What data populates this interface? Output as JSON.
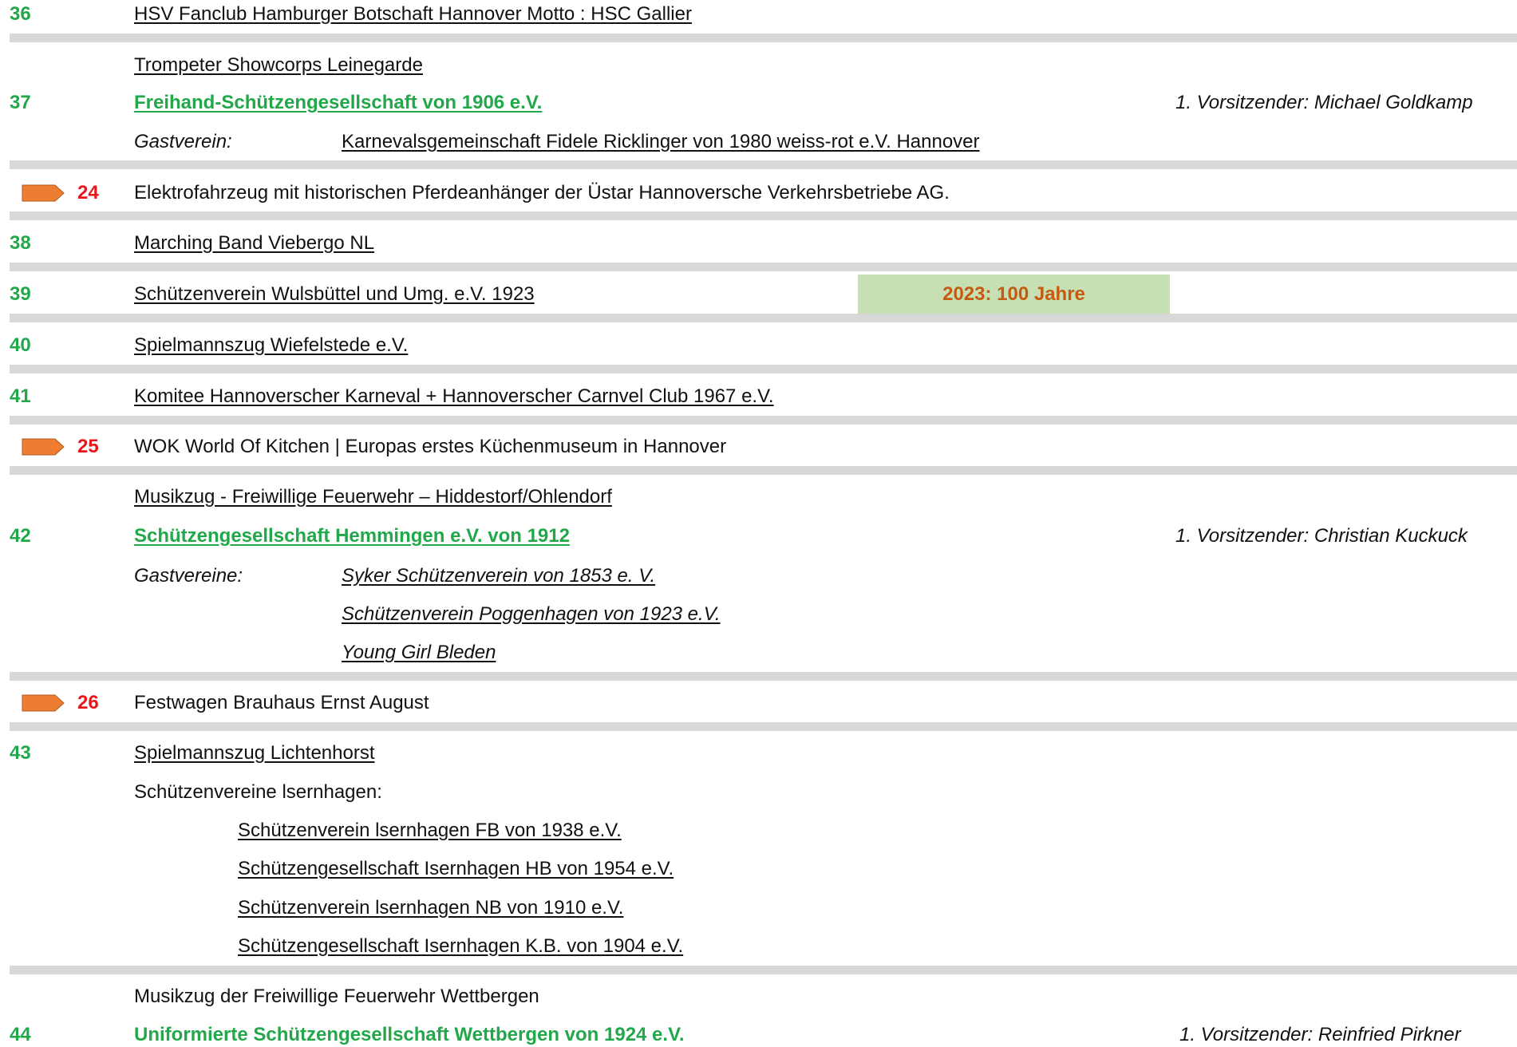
{
  "colors": {
    "green": "#22a84a",
    "red": "#e8161b",
    "arrow": "#ed7d31",
    "separator": "#d8d8d8",
    "badge_bg": "#c6e0b4",
    "badge_text": "#c55a11"
  },
  "icons": {
    "marker": "arrow-right-shape-icon"
  },
  "rows": {
    "r36": {
      "num": "36",
      "name": "HSV Fanclub Hamburger Botschaft Hannover Motto : HSC Gallier"
    },
    "r37": {
      "pre": "Trompeter Showcorps Leinegarde",
      "num": "37",
      "name": "Freihand-Schützengesellschaft von 1906 e.V.",
      "chair": "1. Vorsitzender: Michael Goldkamp",
      "guest_label": "Gastverein:",
      "guest": "Karnevalsgemeinschaft Fidele Ricklinger von 1980 weiss-rot e.V. Hannover"
    },
    "w24": {
      "num": "24",
      "name": "Elektrofahrzeug mit historischen Pferdeanhänger  der Üstar Hannoversche Verkehrsbetriebe AG."
    },
    "r38": {
      "num": "38",
      "name": "Marching Band Viebergo NL"
    },
    "r39": {
      "num": "39",
      "name": "Schützenverein Wulsbüttel und Umg. e.V. 1923",
      "badge": "2023: 100 Jahre"
    },
    "r40": {
      "num": "40",
      "name": "Spielmannszug Wiefelstede e.V."
    },
    "r41": {
      "num": "41",
      "name": "Komitee Hannoverscher Karneval + Hannoverscher Carnvel Club 1967 e.V."
    },
    "w25": {
      "num": "25",
      "name": "WOK World Of Kitchen | Europas erstes Küchenmuseum in Hannover"
    },
    "r42": {
      "pre": "Musikzug - Freiwillige Feuerwehr – Hiddestorf/Ohlendorf",
      "num": "42",
      "name": "Schützengesellschaft Hemmingen e.V. von 1912",
      "chair": "1. Vorsitzender: Christian Kuckuck",
      "guest_label": "Gastvereine:",
      "guests": [
        "Syker Schützenverein von 1853 e. V.",
        "Schützenverein Poggenhagen von 1923 e.V.",
        "Young Girl Bleden "
      ]
    },
    "w26": {
      "num": "26",
      "name": "Festwagen Brauhaus Ernst August"
    },
    "r43": {
      "num": "43",
      "name": "Spielmannszug Lichtenhorst",
      "group_label": "Schützenvereine lsernhagen:",
      "clubs": [
        "Schützenverein lsernhagen FB von 1938 e.V.",
        "Schützengesellschaft Isernhagen HB von 1954 e.V.",
        "Schützenverein lsernhagen NB von 1910 e.V. ",
        "Schützengesellschaft Isernhagen K.B. von 1904 e.V."
      ]
    },
    "r44": {
      "pre": "Musikzug der Freiwillige Feuerwehr Wettbergen",
      "num": "44",
      "name": "Uniformierte Schützengesellschaft Wettbergen von 1924 e.V.",
      "chair": "1. Vorsitzender: Reinfried Pirkner"
    }
  }
}
